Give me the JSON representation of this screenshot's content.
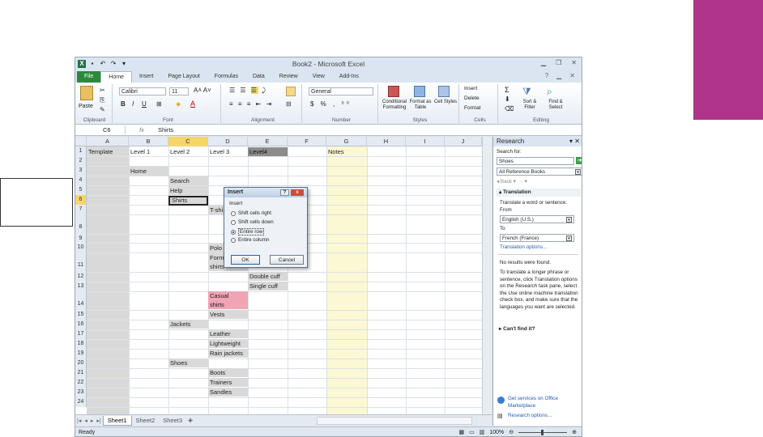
{
  "window": {
    "title": "Book2 - Microsoft Excel"
  },
  "tabs": [
    "File",
    "Home",
    "Insert",
    "Page Layout",
    "Formulas",
    "Data",
    "Review",
    "View",
    "Add-Ins"
  ],
  "ribbon": {
    "clipboard": {
      "label": "Clipboard",
      "paste": "Paste"
    },
    "font": {
      "label": "Font",
      "name": "Calibri",
      "size": "11",
      "bold": "B",
      "italic": "I",
      "underline": "U"
    },
    "alignment": {
      "label": "Alignment"
    },
    "number": {
      "label": "Number",
      "format": "General"
    },
    "styles": {
      "label": "Styles",
      "conditional": "Conditional Formatting",
      "format_table": "Format as Table",
      "cell_styles": "Cell Styles"
    },
    "cells": {
      "label": "Cells",
      "insert": "Insert",
      "delete": "Delete",
      "format": "Format"
    },
    "editing": {
      "label": "Editing",
      "sort": "Sort & Filter",
      "find": "Find & Select"
    }
  },
  "formula_bar": {
    "name_box": "C6",
    "fx": "fx",
    "value": "Shirts"
  },
  "columns": [
    "A",
    "B",
    "C",
    "D",
    "E",
    "F",
    "G",
    "H",
    "I",
    "J"
  ],
  "rows": [
    "1",
    "2",
    "3",
    "4",
    "5",
    "6",
    "7",
    "8",
    "9",
    "10",
    "11",
    "12",
    "13",
    "14",
    "15",
    "16",
    "17",
    "18",
    "19",
    "20",
    "21",
    "22",
    "23",
    "24"
  ],
  "cells": {
    "A1": "Template",
    "B1": "Level 1",
    "C1": "Level 2",
    "D1": "Level 3",
    "E1": "Level4",
    "G1": "Notes",
    "B3": "Home",
    "C4": "Search",
    "C5": "Help",
    "C6": "Shirts",
    "D7": "T-shi",
    "D10": "Polo",
    "D11a": "Form",
    "D11b": "shirts",
    "E12": "Double cuff",
    "E13": "Single cuff",
    "D14a": "Casual",
    "D14b": "shirts",
    "D15": "Vests",
    "C16": "Jackets",
    "D17": "Leather",
    "D18": "Lightweight",
    "D19": "Rain jackets",
    "C20": "Shoes",
    "D21": "Boots",
    "D22": "Trainers",
    "D23": "Sandles"
  },
  "dialog": {
    "title": "Insert",
    "help": "?",
    "close": "x",
    "group": "Insert",
    "options": [
      "Shift cells right",
      "Shift cells down",
      "Entire row",
      "Entire column"
    ],
    "selected": 2,
    "ok": "OK",
    "cancel": "Cancel"
  },
  "sheets": [
    "Sheet1",
    "Sheet2",
    "Sheet3"
  ],
  "status": {
    "ready": "Ready",
    "zoom": "100%"
  },
  "research": {
    "title": "Research",
    "search_for": "Search for:",
    "query": "Shoes",
    "source": "All Reference Books",
    "back": "Back",
    "translation": "Translation",
    "translate_text": "Translate a word or sentence.",
    "from_label": "From",
    "from": "English (U.S.)",
    "to_label": "To",
    "to": "French (France)",
    "options_link": "Translation options...",
    "no_results": "No results were found.",
    "hint": "To translate a longer phrase or sentence, click Translation options on the Research task pane, select the Use online machine translation check box, and make sure that the languages you want are selected.",
    "cant_find": "Can't find it?",
    "services_link": "Get services on Office Marketplace",
    "research_options": "Research options..."
  }
}
